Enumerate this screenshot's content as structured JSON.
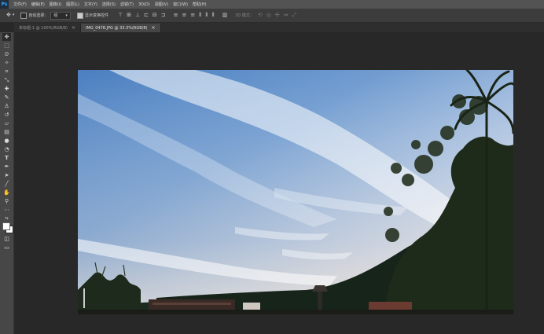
{
  "app": {
    "logo": "Ps"
  },
  "menu": [
    "文件(F)",
    "编辑(E)",
    "图像(I)",
    "图层(L)",
    "文字(Y)",
    "选择(S)",
    "滤镜(T)",
    "3D(D)",
    "视图(V)",
    "窗口(W)",
    "帮助(H)"
  ],
  "options": {
    "auto_select_label": "自动选择：",
    "auto_select_value": "组",
    "show_transform_label": "显示变换控件",
    "mode_3d_label": "3D 模式："
  },
  "tabs": [
    {
      "label": "未标题-1 @ 100%(RGB/8)"
    },
    {
      "label": "IMG_0478.JPG @ 33.3%(RGB/8)"
    }
  ],
  "tools": [
    "move-icon",
    "marquee-icon",
    "lasso-icon",
    "magic-wand-icon",
    "crop-icon",
    "eyedropper-icon",
    "healing-brush-icon",
    "brush-icon",
    "clone-stamp-icon",
    "history-brush-icon",
    "eraser-icon",
    "gradient-icon",
    "blur-icon",
    "dodge-icon",
    "pen-icon",
    "type-icon",
    "path-selection-icon",
    "rectangle-icon",
    "hand-icon",
    "zoom-icon",
    "more-tools-icon"
  ],
  "colors": {
    "foreground": "#ffffff",
    "background": "#ffffff",
    "accent": "#31a8ff"
  }
}
